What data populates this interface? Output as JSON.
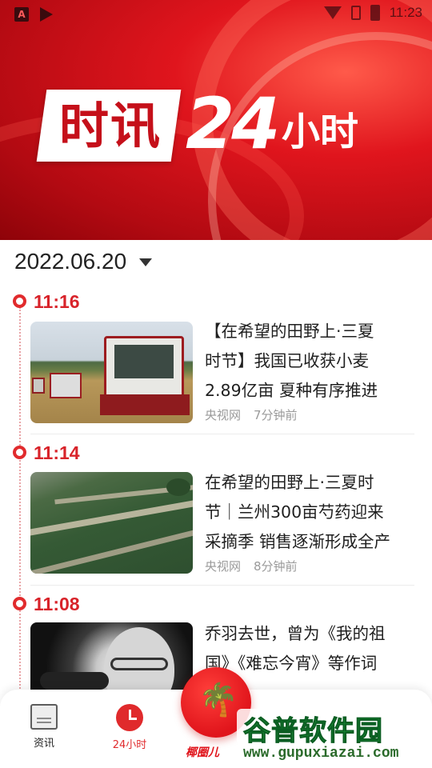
{
  "status_bar": {
    "time": "11:23"
  },
  "banner": {
    "logo_box_text": "时讯",
    "logo_number": "24",
    "logo_word": "小时"
  },
  "date_selector": {
    "date": "2022.06.20"
  },
  "timeline": [
    {
      "time": "11:16",
      "title_lines": [
        "【在希望的田野上·三夏",
        "时节】我国已收获小麦",
        "2.89亿亩 夏种有序推进"
      ],
      "source": "央视网",
      "age": "7分钟前",
      "image_icon": "wheat-harvester-photo"
    },
    {
      "time": "11:14",
      "title_lines": [
        "在希望的田野上·三夏时",
        "节｜兰州300亩芍药迎来",
        "采摘季 销售逐渐形成全产"
      ],
      "source": "央视网",
      "age": "8分钟前",
      "image_icon": "peony-field-photo"
    },
    {
      "time": "11:08",
      "title_lines": [
        "乔羽去世，曾为《我的祖",
        "国》《难忘今宵》等作词"
      ],
      "image_icon": "portrait-photo"
    }
  ],
  "bottom_nav": {
    "items": [
      {
        "label": "资讯",
        "icon": "news-icon"
      },
      {
        "label": "24小时",
        "icon": "clock-icon"
      }
    ],
    "center_label": "椰圈儿",
    "accent": "#e0141b"
  },
  "watermark": {
    "title": "谷普软件园",
    "url": "www.gupuxiazai.com"
  },
  "colors": {
    "brand_red": "#d8232a",
    "banner_red": "#e0151d"
  }
}
